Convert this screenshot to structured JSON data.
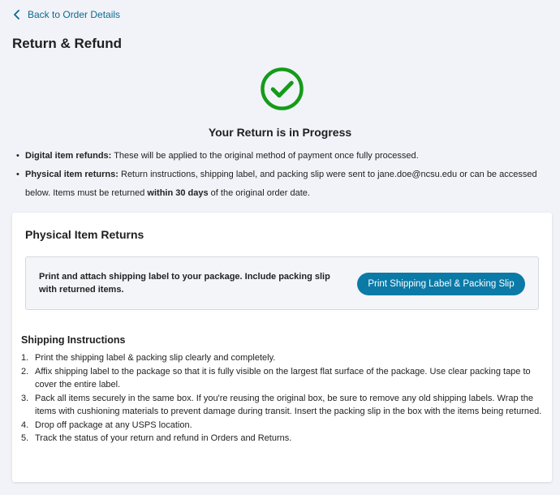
{
  "nav": {
    "back_label": "Back to Order Details"
  },
  "page": {
    "title": "Return & Refund"
  },
  "status": {
    "heading": "Your Return is in Progress",
    "icon": "check-circle-icon",
    "icon_color": "#159b1a"
  },
  "info": {
    "digital_label": "Digital item refunds:",
    "digital_text": " These will be applied to the original method of payment once fully processed.",
    "physical_label": "Physical item returns:",
    "physical_text": " Return instructions, shipping label, and packing slip were sent to jane.doe@ncsu.edu or can be accessed below. Items must be returned ",
    "physical_bold": "within 30 days",
    "physical_tail": " of the original order date."
  },
  "returns_card": {
    "title": "Physical Item Returns",
    "notice_text": "Print and attach shipping label to your package. Include packing slip with returned items.",
    "print_button_label": "Print Shipping Label & Packing Slip",
    "accent_color": "#0b7aa7"
  },
  "shipping": {
    "title": "Shipping Instructions",
    "steps": [
      {
        "num": "1.",
        "text": "Print the shipping label & packing slip clearly and completely."
      },
      {
        "num": "2.",
        "text": "Affix shipping label to the package so that it is fully visible on the largest flat surface of the package. Use clear packing tape to cover the entire label."
      },
      {
        "num": "3.",
        "text": "Pack all items securely in the same box. If you're reusing the original box, be sure to remove any old shipping labels. Wrap the items with cushioning materials to prevent damage during transit. Insert the packing slip in the box with the items being returned."
      },
      {
        "num": "4.",
        "text": "Drop off package at any USPS location."
      },
      {
        "num": "5.",
        "text": "Track the status of your return and refund in Orders and Returns."
      }
    ]
  }
}
